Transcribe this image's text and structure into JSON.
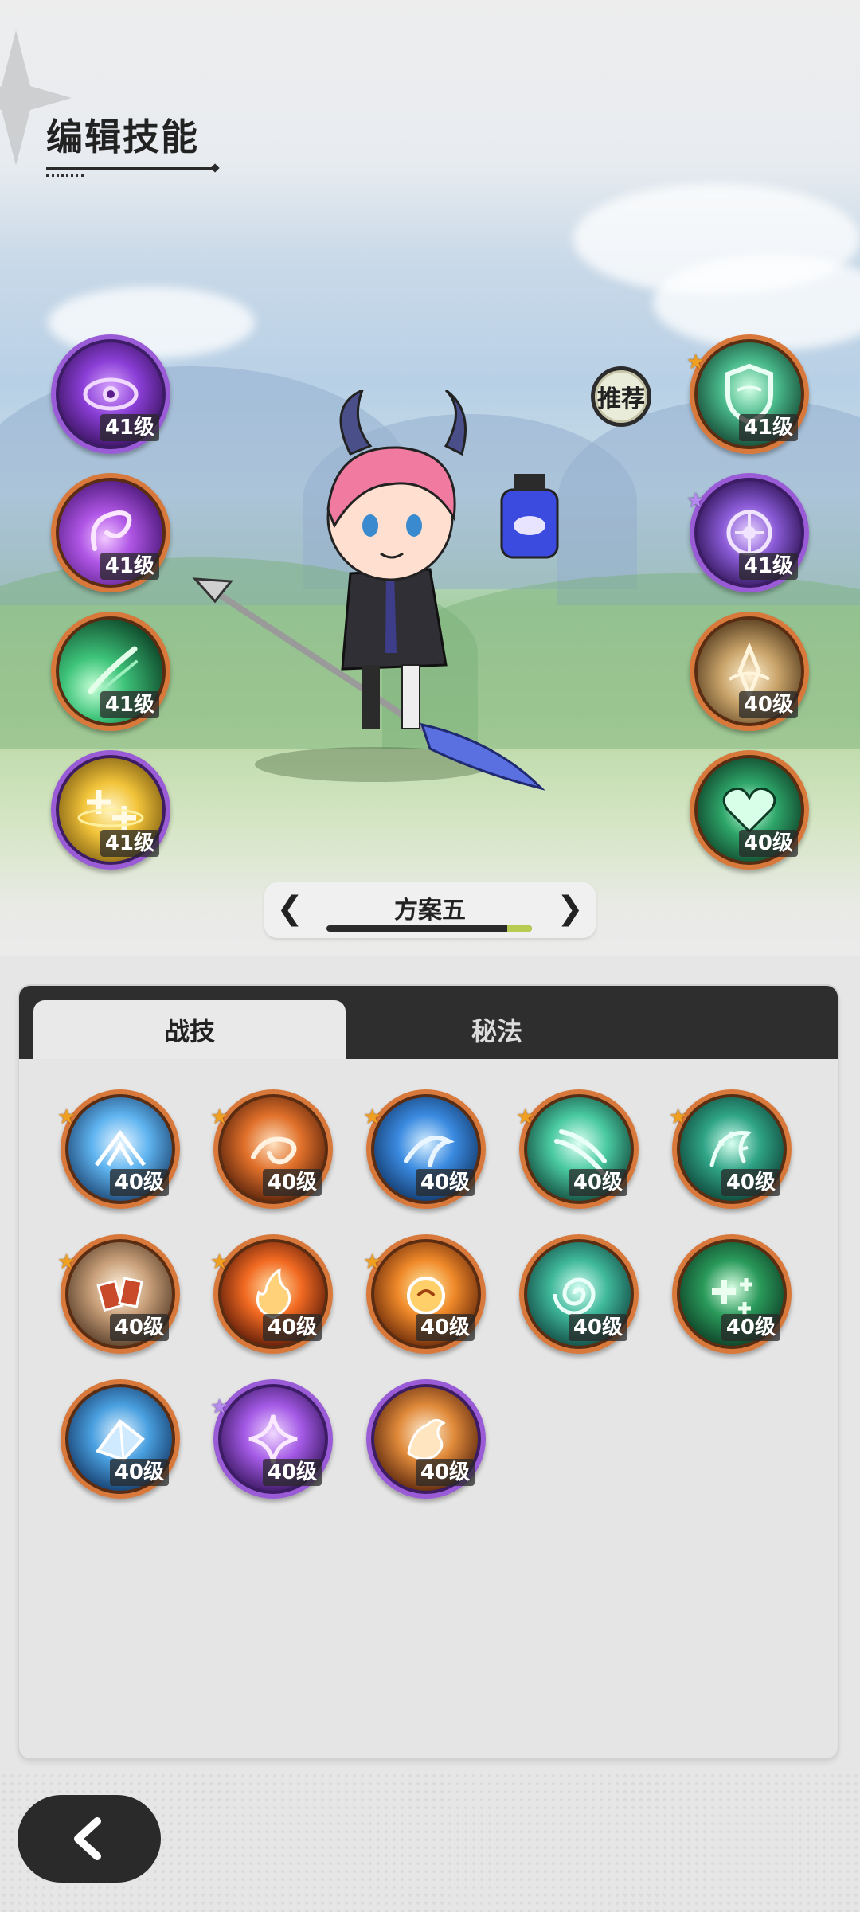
{
  "header": {
    "title": "编辑技能"
  },
  "recommend_label": "推荐",
  "left_skills": [
    {
      "icon": "purple-eye-icon",
      "level": "41级",
      "tier": "purple"
    },
    {
      "icon": "purple-vortex-icon",
      "level": "41级",
      "tier": "orange"
    },
    {
      "icon": "green-wind-icon",
      "level": "41级",
      "tier": "orange"
    },
    {
      "icon": "golden-sparkle-icon",
      "level": "41级",
      "tier": "purple"
    }
  ],
  "right_skills": [
    {
      "icon": "green-shield-icon",
      "level": "41级",
      "tier": "orange",
      "star": "orange"
    },
    {
      "icon": "purple-rune-icon",
      "level": "41级",
      "tier": "purple",
      "star": "purple"
    },
    {
      "icon": "golden-flow-icon",
      "level": "40级",
      "tier": "orange"
    },
    {
      "icon": "green-heart-icon",
      "level": "40级",
      "tier": "orange"
    }
  ],
  "scheme": {
    "name": "方案五",
    "progress": 0.12
  },
  "tabs": [
    {
      "label": "战技",
      "active": true
    },
    {
      "label": "秘法",
      "active": false
    }
  ],
  "skill_grid": [
    {
      "icon": "ice-burst-icon",
      "level": "40级",
      "tier": "orange",
      "star": "orange"
    },
    {
      "icon": "fire-swirl-icon",
      "level": "40级",
      "tier": "orange",
      "star": "orange"
    },
    {
      "icon": "water-splash-icon",
      "level": "40级",
      "tier": "orange",
      "star": "orange"
    },
    {
      "icon": "wind-slash-icon",
      "level": "40级",
      "tier": "orange",
      "star": "orange"
    },
    {
      "icon": "thorn-vine-icon",
      "level": "40级",
      "tier": "orange",
      "star": "orange"
    },
    {
      "icon": "card-throw-icon",
      "level": "40级",
      "tier": "orange",
      "star": "orange"
    },
    {
      "icon": "flame-icon",
      "level": "40级",
      "tier": "orange",
      "star": "orange"
    },
    {
      "icon": "fireball-icon",
      "level": "40级",
      "tier": "orange",
      "star": "orange"
    },
    {
      "icon": "water-vortex-icon",
      "level": "40级",
      "tier": "orange"
    },
    {
      "icon": "green-cross-icon",
      "level": "40级",
      "tier": "orange"
    },
    {
      "icon": "ice-crystal-icon",
      "level": "40级",
      "tier": "orange"
    },
    {
      "icon": "purple-star-icon",
      "level": "40级",
      "tier": "purple",
      "star": "purple"
    },
    {
      "icon": "fire-beast-icon",
      "level": "40级",
      "tier": "purple"
    }
  ],
  "colors": {
    "orange_frame": "#d8783a",
    "purple_frame": "#9a5bd6",
    "progress": "#b8cc52",
    "tab_bar": "#2e2e2e"
  }
}
